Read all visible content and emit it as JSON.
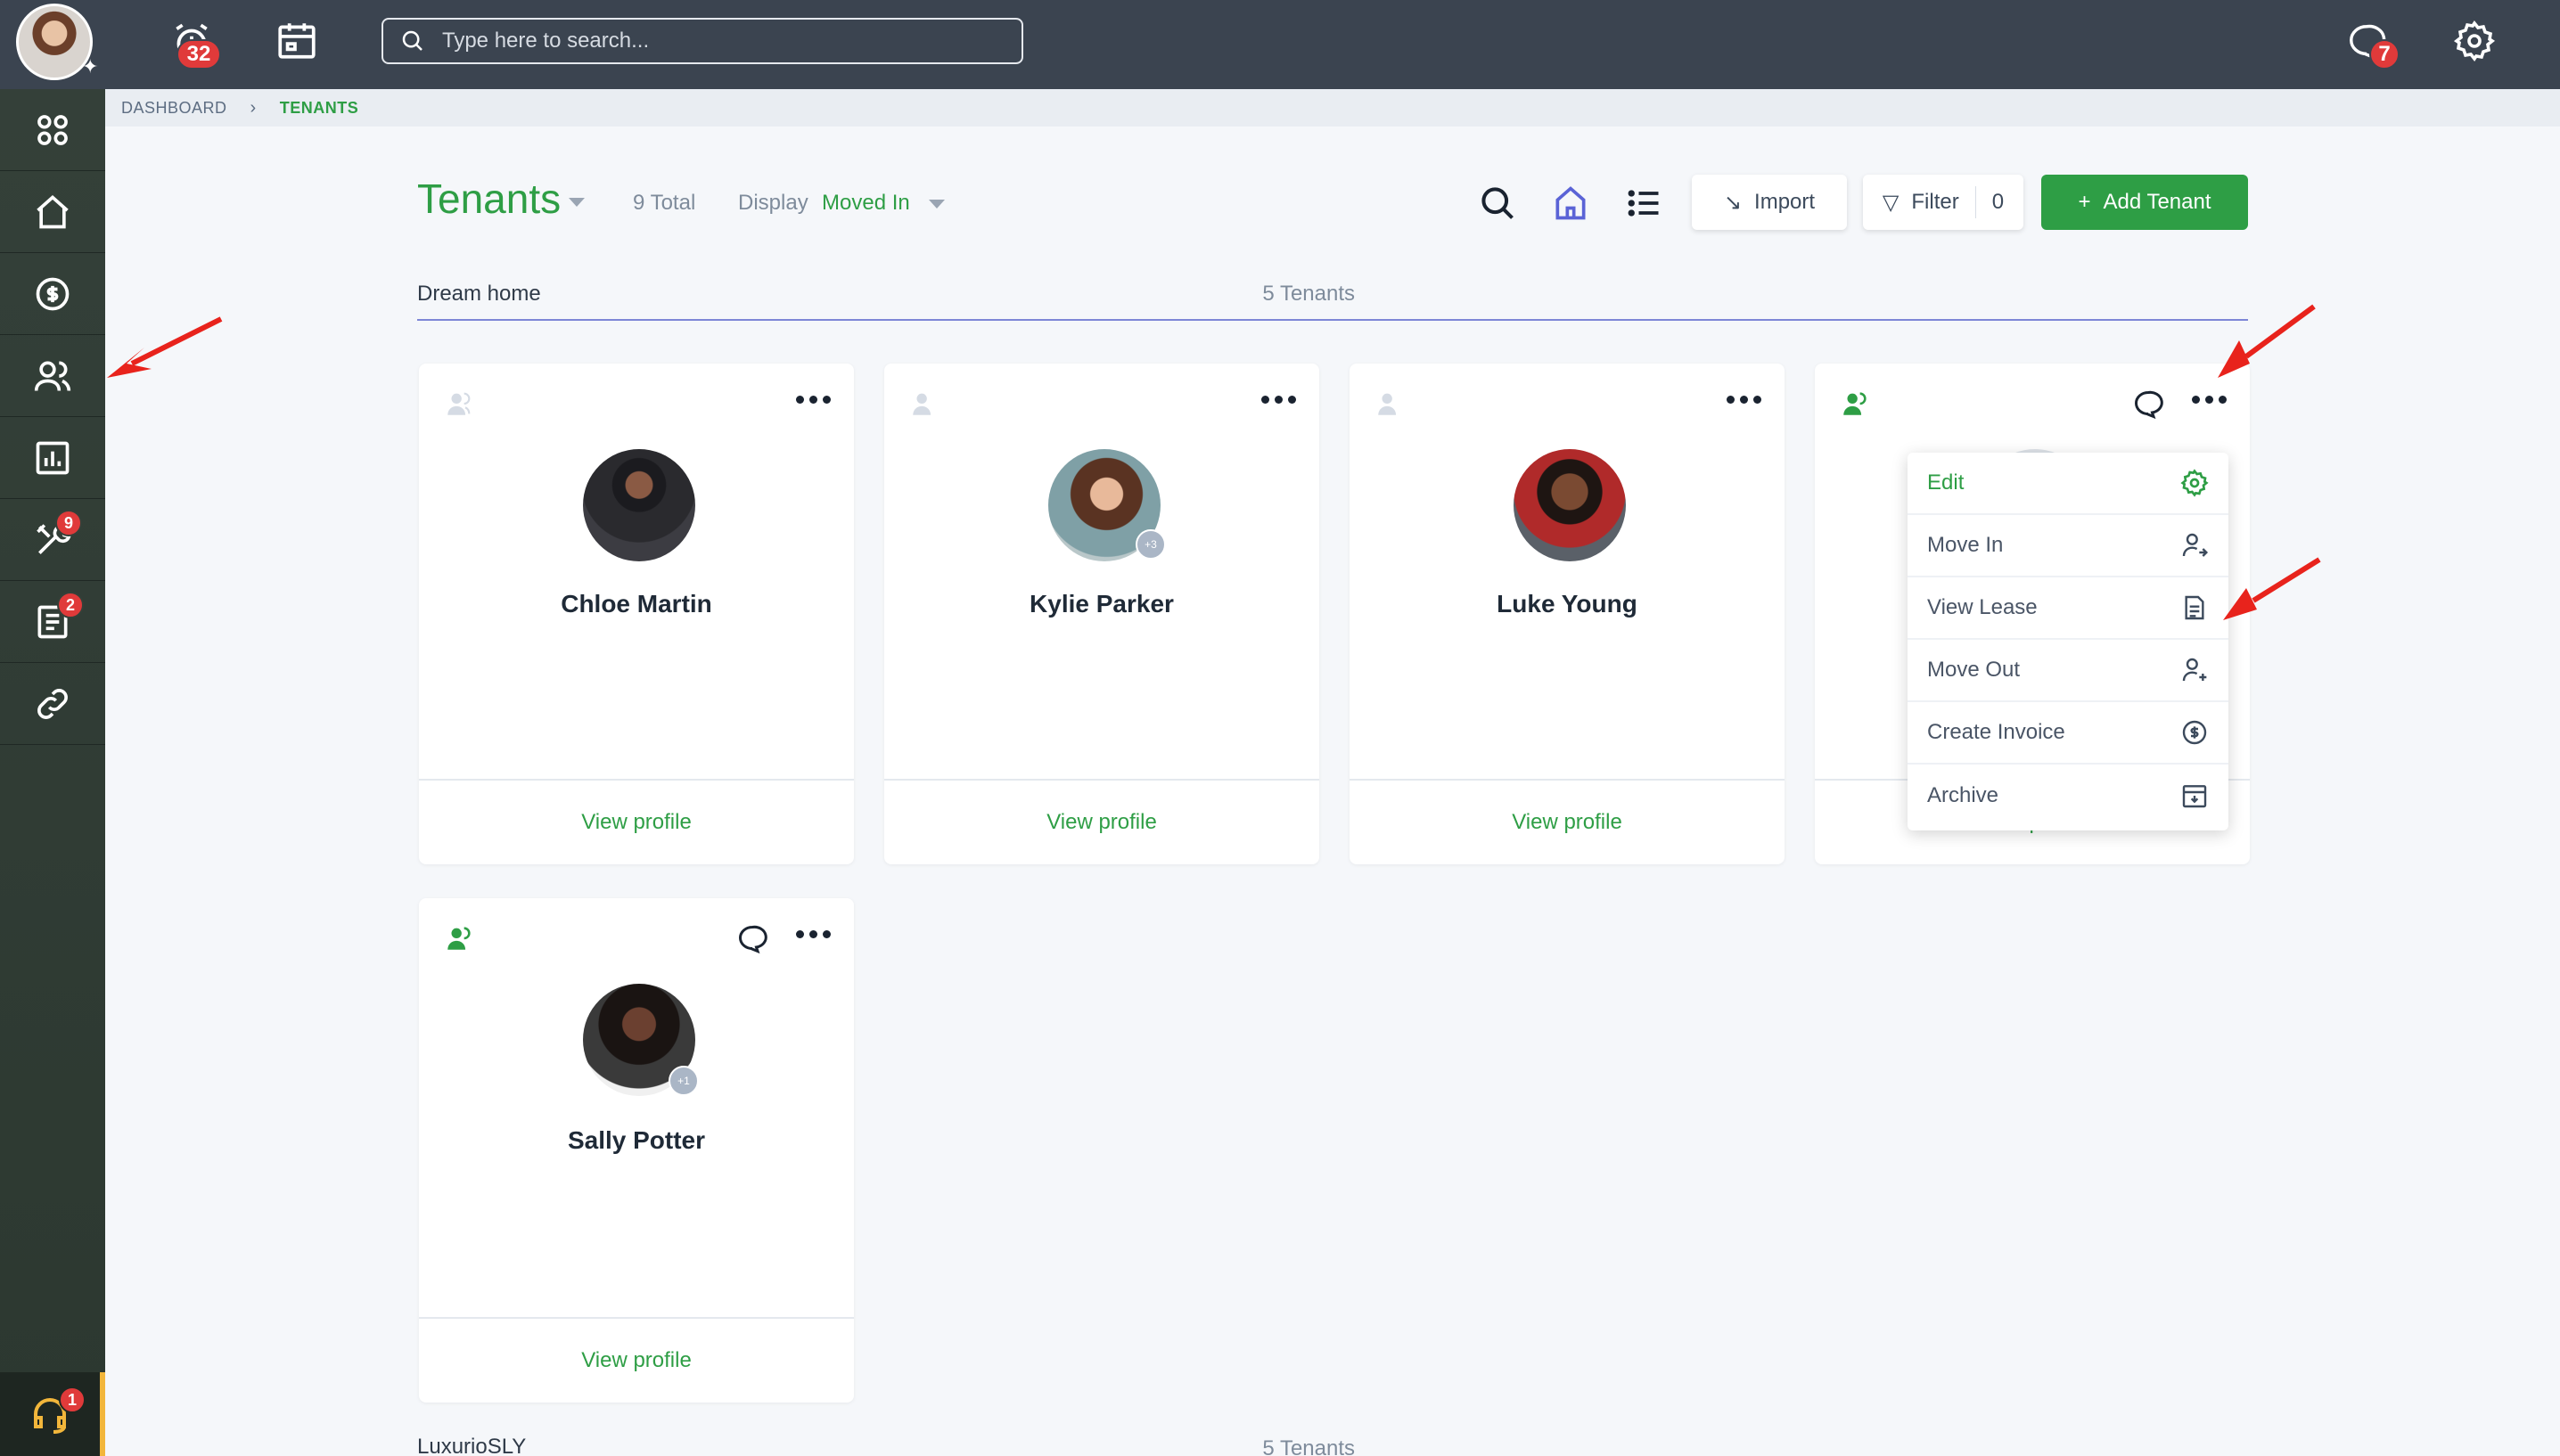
{
  "topbar": {
    "alarm_badge": "32",
    "search_placeholder": "Type here to search...",
    "messages_badge": "7"
  },
  "sidebar": {
    "maintenance_badge": "9",
    "documents_badge": "2",
    "support_badge": "1"
  },
  "breadcrumb": {
    "root": "DASHBOARD",
    "current": "TENANTS"
  },
  "header": {
    "title": "Tenants",
    "total": "9 Total",
    "display_label": "Display",
    "display_value": "Moved In",
    "import_label": "Import",
    "filter_label": "Filter",
    "filter_count": "0",
    "add_label": "Add Tenant"
  },
  "groups": [
    {
      "name": "Dream home",
      "count": "5 Tenants"
    },
    {
      "name": "LuxurioSLY",
      "count": "5 Tenants"
    }
  ],
  "cards": [
    {
      "name": "Chloe Martin",
      "link": "View profile"
    },
    {
      "name": "Kylie Parker",
      "link": "View profile",
      "extra": "+3"
    },
    {
      "name": "Luke Young",
      "link": "View profile"
    },
    {
      "name": "",
      "link": "View profile"
    },
    {
      "name": "Sally Potter",
      "link": "View profile",
      "extra": "+1"
    }
  ],
  "menu": {
    "items": [
      {
        "label": "Edit",
        "icon": "gear-icon"
      },
      {
        "label": "Move In",
        "icon": "user-move-in-icon"
      },
      {
        "label": "View Lease",
        "icon": "document-icon"
      },
      {
        "label": "Move Out",
        "icon": "user-move-out-icon"
      },
      {
        "label": "Create Invoice",
        "icon": "dollar-icon"
      },
      {
        "label": "Archive",
        "icon": "archive-icon"
      }
    ]
  },
  "colors": {
    "accent_green": "#2e9e45",
    "topbar": "#3b4450",
    "sidebar": "#344039",
    "badge_red": "#e03a3a",
    "annotation_arrow": "#e8231c"
  }
}
